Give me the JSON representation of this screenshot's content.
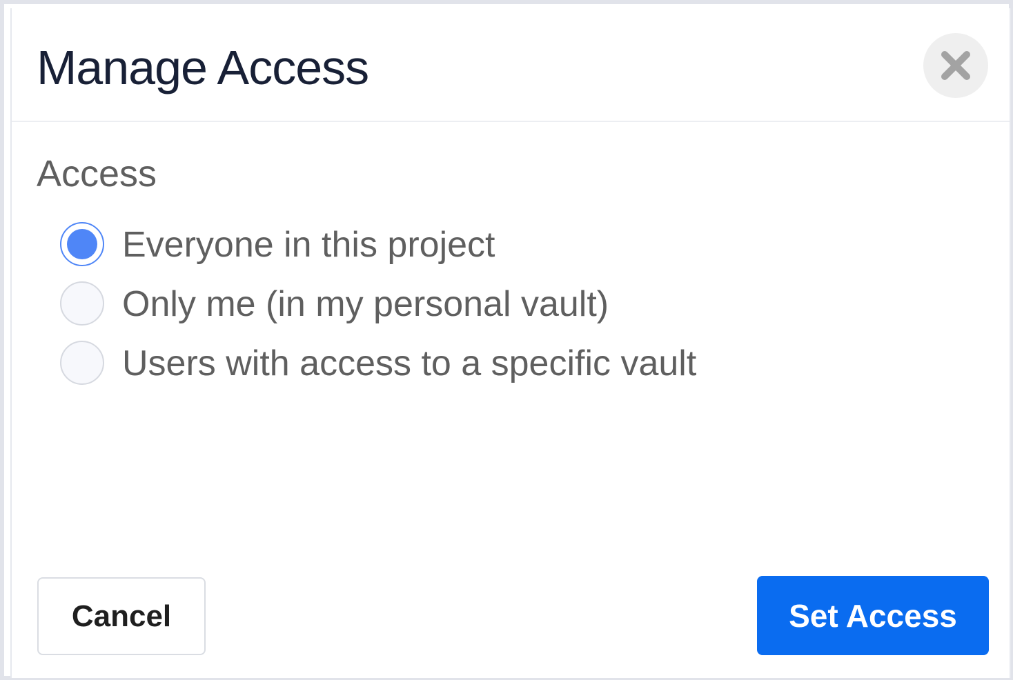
{
  "dialog": {
    "title": "Manage Access",
    "close_icon": "close-icon"
  },
  "access": {
    "label": "Access",
    "options": [
      {
        "label": "Everyone in this project",
        "selected": true
      },
      {
        "label": "Only me (in my personal vault)",
        "selected": false
      },
      {
        "label": "Users with access to a specific vault",
        "selected": false
      }
    ]
  },
  "footer": {
    "cancel_label": "Cancel",
    "submit_label": "Set Access"
  },
  "colors": {
    "accent": "#0a6cf0",
    "radio_selected": "#4f86f7",
    "title_text": "#182036",
    "body_text": "#5f5f5f"
  }
}
